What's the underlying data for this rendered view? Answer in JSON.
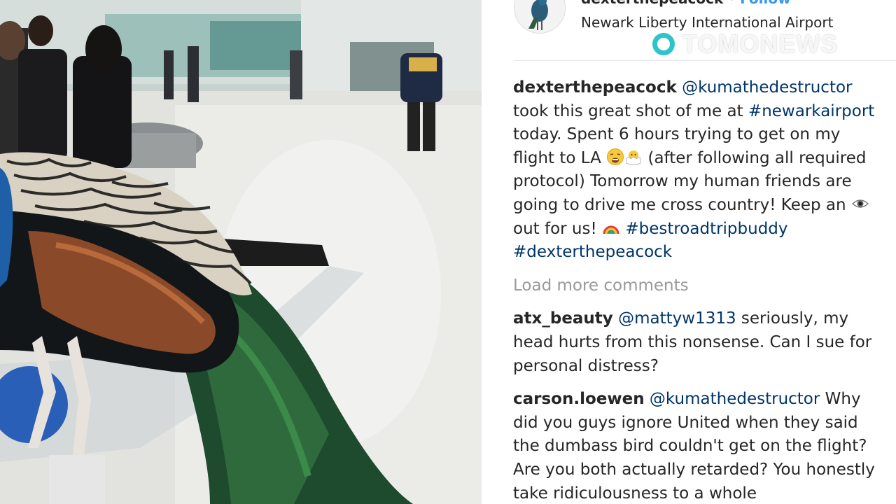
{
  "post": {
    "username": "dexterthepeacock",
    "separator": "•",
    "follow_label": "Follow",
    "location": "Newark Liberty International Airport"
  },
  "caption": {
    "user": "dexterthepeacock",
    "mention": "@kumathedestructor",
    "text1": " took this great shot of me at ",
    "hashtag1": "#newarkairport",
    "text2": " today. Spent 6 hours trying to get on my flight to LA ",
    "text3": " (after following all required protocol) Tomorrow my human friends are going to drive me cross country! Keep an ",
    "text4": "out for us! ",
    "hashtag2": "#bestroadtripbuddy",
    "hashtag3": "#dexterthepeacock"
  },
  "load_more_label": "Load more comments",
  "comments": [
    {
      "user": "atx_beauty",
      "mention": "@mattyw1313",
      "text": " seriously, my head hurts from this nonsense. Can I sue for personal distress?"
    },
    {
      "user": "carson.loewen",
      "mention": "@kumathedestructor",
      "text": " Why did you guys ignore United when they said the dumbass bird couldn't get on the flight? Are you both actually retarded? You honestly take ridiculousness to a whole"
    }
  ],
  "watermark": {
    "text": "TOMONEWS"
  },
  "icons": [
    "avatar-peacock-icon",
    "weary-face-emoji-icon",
    "hatching-chick-emoji-icon",
    "eye-emoji-icon",
    "rainbow-emoji-icon",
    "tomonews-logo-icon"
  ],
  "colors": {
    "link": "#003569",
    "follow": "#3897f0",
    "muted": "#999999",
    "text": "#262626",
    "brand": "#2ec4c9"
  }
}
